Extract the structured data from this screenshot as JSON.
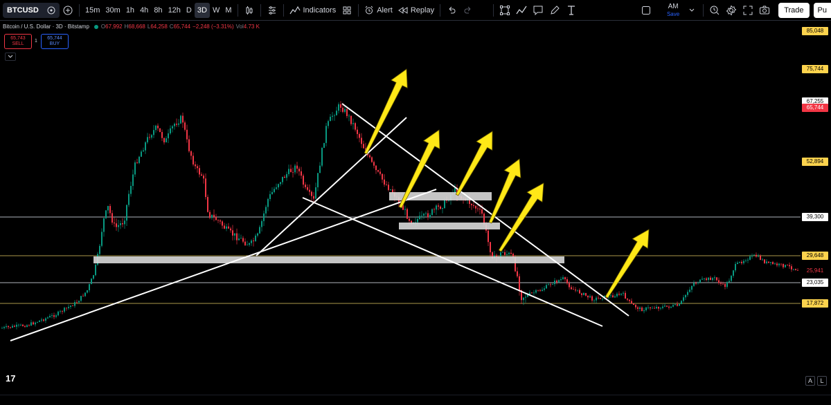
{
  "toolbar": {
    "symbol": "BTCUSD",
    "intervals": [
      "15m",
      "30m",
      "1h",
      "4h",
      "8h",
      "12h",
      "D",
      "3D",
      "W",
      "M"
    ],
    "active_interval": "3D",
    "indicators_label": "Indicators",
    "alert_label": "Alert",
    "replay_label": "Replay",
    "layout_name": "AM",
    "save_label": "Save",
    "trade_label": "Trade",
    "publish_label": "Pu"
  },
  "legend": {
    "title": "Bitcoin / U.S. Dollar · 3D · Bitstamp",
    "o_label": "O",
    "o_value": "67,992",
    "h_label": "H",
    "h_value": "68,668",
    "l_label": "L",
    "l_value": "64,258",
    "c_label": "C",
    "c_value": "65,744",
    "change": "−2,248 (−3.31%)",
    "vol_label": "Vol",
    "vol_value": "4.73 K"
  },
  "order": {
    "sell_price": "65,743",
    "sell_label": "SELL",
    "quantity": "1",
    "buy_price": "65,744",
    "buy_label": "BUY"
  },
  "price_labels": [
    {
      "text": "85,048",
      "style": "yellow",
      "price": 85048
    },
    {
      "text": "75,744",
      "style": "yellow",
      "price": 75744
    },
    {
      "text": "67,255",
      "style": "white",
      "price": 67255
    },
    {
      "text": "65,744",
      "style": "red",
      "price": 65744
    },
    {
      "text": "52,894",
      "style": "yellow",
      "price": 52894
    },
    {
      "text": "39,300",
      "style": "white",
      "price": 39300
    },
    {
      "text": "29,648",
      "style": "yellow",
      "price": 29648
    },
    {
      "text": "25,941",
      "style": "red-outline",
      "price": 25941
    },
    {
      "text": "23,035",
      "style": "white",
      "price": 23035
    },
    {
      "text": "17,872",
      "style": "yellow",
      "price": 17872
    }
  ],
  "horizontal_levels": [
    {
      "price": 39300,
      "color": "#d1d4dc"
    },
    {
      "price": 29648,
      "color": "#c9b458"
    },
    {
      "price": 23035,
      "color": "#d1d4dc"
    },
    {
      "price": 17872,
      "color": "#c9b458"
    }
  ],
  "colors": {
    "up": "#089981",
    "down": "#f23645",
    "arrow": "#ffe817",
    "zone": "#d9d9d9",
    "trendline": "#ffffff"
  },
  "icons": [
    "plus-icon",
    "candles-icon",
    "compare-icon",
    "indicators-icon",
    "templates-icon",
    "alert-icon",
    "replay-icon",
    "undo-icon",
    "redo-icon",
    "selection-icon",
    "line-tool-icon",
    "note-icon",
    "pen-icon",
    "text-icon",
    "fullscreen-icon",
    "quick-search-icon",
    "settings-icon",
    "maximize-icon",
    "camera-icon",
    "tv-logo-icon"
  ],
  "logo_text": "17",
  "axis_buttons": {
    "auto": "A",
    "log": "L"
  }
}
